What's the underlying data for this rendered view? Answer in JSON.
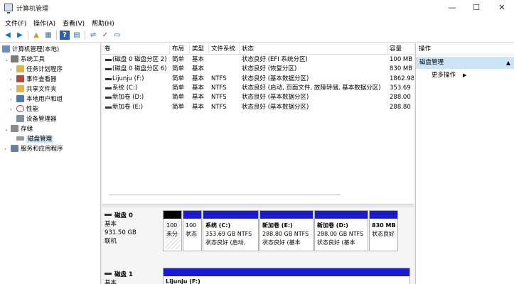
{
  "window": {
    "title": "计算机管理",
    "controls": {
      "minimize": "—",
      "maximize": "☐",
      "close": "✕"
    }
  },
  "menu": [
    "文件(F)",
    "操作(A)",
    "查看(V)",
    "帮助(H)"
  ],
  "toolbar_icons": [
    "back-icon",
    "forward-icon",
    "up-folder-icon",
    "show-tree-icon",
    "help-icon",
    "properties-icon",
    "connect-icon",
    "check-icon",
    "console-icon"
  ],
  "tree": {
    "root": "计算机管理(本地)",
    "system_tools": "系统工具",
    "task_scheduler": "任务计划程序",
    "event_viewer": "事件查看器",
    "shared_folders": "共享文件夹",
    "local_users": "本地用户和组",
    "performance": "性能",
    "device_manager": "设备管理器",
    "storage": "存储",
    "disk_management": "磁盘管理",
    "services_apps": "服务和应用程序"
  },
  "volume_list": {
    "columns": [
      "卷",
      "布局",
      "类型",
      "文件系统",
      "状态",
      "容量"
    ],
    "rows": [
      {
        "volume": "(磁盘 0 磁盘分区 2)",
        "layout": "简单",
        "type": "基本",
        "fs": "",
        "status": "状态良好 (EFI 系统分区)",
        "capacity": "100 MB"
      },
      {
        "volume": "(磁盘 0 磁盘分区 6)",
        "layout": "简单",
        "type": "基本",
        "fs": "",
        "status": "状态良好 (恢复分区)",
        "capacity": "830 MB"
      },
      {
        "volume": "Lijunju (F:)",
        "layout": "简单",
        "type": "基本",
        "fs": "NTFS",
        "status": "状态良好 (基本数据分区)",
        "capacity": "1862.98"
      },
      {
        "volume": "系统 (C:)",
        "layout": "简单",
        "type": "基本",
        "fs": "NTFS",
        "status": "状态良好 (启动, 页面文件, 故障转储, 基本数据分区)",
        "capacity": "353.69"
      },
      {
        "volume": "新加卷 (D:)",
        "layout": "简单",
        "type": "基本",
        "fs": "NTFS",
        "status": "状态良好 (基本数据分区)",
        "capacity": "288.00"
      },
      {
        "volume": "新加卷 (E:)",
        "layout": "简单",
        "type": "基本",
        "fs": "NTFS",
        "status": "状态良好 (基本数据分区)",
        "capacity": "288.80"
      }
    ]
  },
  "disks": [
    {
      "name": "磁盘 0",
      "kind": "基本",
      "size": "931.50 GB",
      "state": "联机",
      "partitions": [
        {
          "line1": "100",
          "line2": "未分",
          "line3": "",
          "bar": "black",
          "hatched": true
        },
        {
          "line1": "100",
          "line2": "状态",
          "line3": "",
          "bar": "blue",
          "hatched": false
        },
        {
          "line1": "系统 (C:)",
          "line2": "353.69 GB NTFS",
          "line3": "状态良好 (启动,",
          "bar": "blue",
          "hatched": false
        },
        {
          "line1": "新加卷 (E:)",
          "line2": "288.80 GB NTFS",
          "line3": "状态良好 (基本",
          "bar": "blue",
          "hatched": false
        },
        {
          "line1": "新加卷 (D:)",
          "line2": "288.00 GB NTFS",
          "line3": "状态良好 (基本",
          "bar": "blue",
          "hatched": false
        },
        {
          "line1": "830 MB",
          "line2": "状态良好",
          "line3": "",
          "bar": "blue",
          "hatched": false
        }
      ]
    },
    {
      "name": "磁盘 1",
      "kind": "基本",
      "partitions": [
        {
          "line1": "Lijunju (F:)"
        }
      ]
    }
  ],
  "actions": {
    "header": "操作",
    "section": "磁盘管理",
    "more": "更多操作"
  },
  "colors": {
    "selection": "#cce4f7",
    "partition_bar": "#1a1ad6",
    "unallocated_bar": "#000000"
  }
}
